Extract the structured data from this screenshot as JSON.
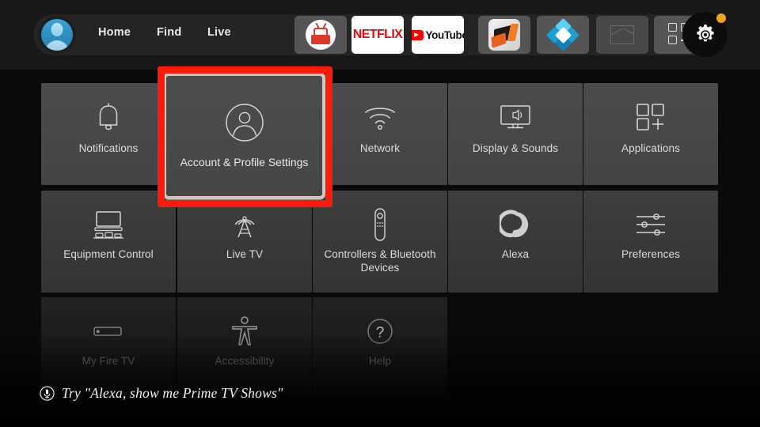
{
  "nav": {
    "avatar_icon": "user-avatar-icon",
    "links": [
      {
        "label": "Home"
      },
      {
        "label": "Find"
      },
      {
        "label": "Live"
      }
    ],
    "apps": [
      {
        "name": "prime-video",
        "icon": "prime-video-icon",
        "label": ""
      },
      {
        "name": "netflix",
        "icon": "netflix-icon",
        "label": "NETFLIX"
      },
      {
        "name": "youtube",
        "icon": "youtube-icon",
        "label": "YouTube"
      },
      {
        "name": "downloader",
        "icon": "downloader-icon",
        "label": ""
      },
      {
        "name": "kodi",
        "icon": "kodi-icon",
        "label": ""
      },
      {
        "name": "photos",
        "icon": "photos-icon",
        "label": ""
      },
      {
        "name": "app-library",
        "icon": "app-grid-plus-icon",
        "label": ""
      }
    ],
    "settings_button": {
      "icon": "gear-icon",
      "badge_visible": true,
      "badge_color": "#f9a11b"
    }
  },
  "grid": {
    "row1": [
      {
        "label": "Notifications",
        "icon": "bell-icon",
        "badge": true,
        "focused": false
      },
      {
        "label": "Account & Profile Settings",
        "icon": "account-profile-icon",
        "badge": false,
        "focused": true
      },
      {
        "label": "Network",
        "icon": "wifi-icon",
        "badge": false,
        "focused": false
      },
      {
        "label": "Display & Sounds",
        "icon": "tv-speaker-icon",
        "badge": false,
        "focused": false
      },
      {
        "label": "Applications",
        "icon": "app-grid-plus-icon",
        "badge": false,
        "focused": false
      }
    ],
    "row2": [
      {
        "label": "Equipment Control",
        "icon": "tv-equipment-icon"
      },
      {
        "label": "Live TV",
        "icon": "broadcast-tower-icon"
      },
      {
        "label": "Controllers & Bluetooth Devices",
        "icon": "remote-control-icon"
      },
      {
        "label": "Alexa",
        "icon": "alexa-ring-icon"
      },
      {
        "label": "Preferences",
        "icon": "sliders-icon"
      }
    ],
    "row3": [
      {
        "label": "My Fire TV",
        "icon": "firetv-stick-icon"
      },
      {
        "label": "Accessibility",
        "icon": "accessibility-person-icon"
      },
      {
        "label": "Help",
        "icon": "question-circle-icon"
      }
    ]
  },
  "annotation": {
    "target": "Account & Profile Settings",
    "color": "#fc1b0a"
  },
  "hint": {
    "icon": "microphone-icon",
    "text": "Try \"Alexa, show me Prime TV Shows\""
  },
  "colors": {
    "background": "#0a0a0a",
    "topbar": "#181818",
    "nav_pill": "#242424",
    "tile_row1": "#4a4a4a",
    "tile_row2": "#3a3a3a",
    "tile_row3": "#1d1d1d",
    "focus_border": "#cfc8bd",
    "accent_orange": "#f4911e",
    "annotation_red": "#fc1b0a"
  }
}
